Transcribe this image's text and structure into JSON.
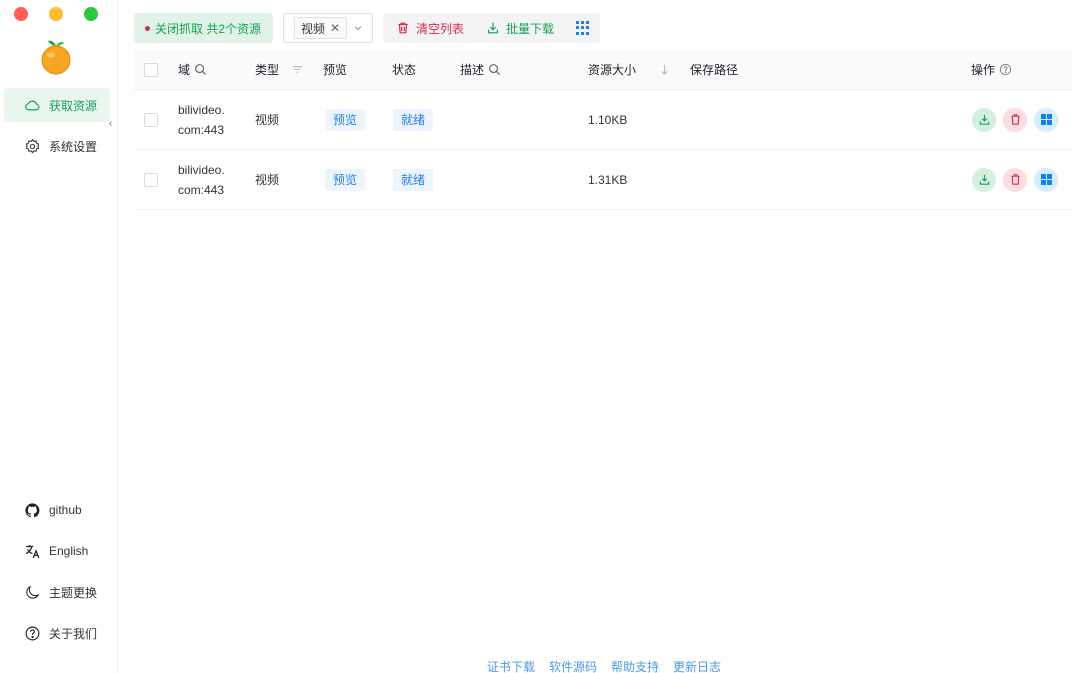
{
  "sidebar": {
    "nav": [
      {
        "label": "获取资源",
        "icon": "cloud-icon",
        "active": true
      },
      {
        "label": "系统设置",
        "icon": "gear-icon",
        "active": false
      }
    ],
    "bottom": [
      {
        "label": "github",
        "icon": "github-icon"
      },
      {
        "label": "English",
        "icon": "translate-icon"
      },
      {
        "label": "主题更换",
        "icon": "moon-icon"
      },
      {
        "label": "关于我们",
        "icon": "help-circle-icon"
      }
    ]
  },
  "toolbar": {
    "capture_label": "关闭抓取 共2个资源",
    "filter_tag": "视频",
    "clear_label": "清空列表",
    "batch_label": "批量下载"
  },
  "table": {
    "headers": {
      "domain": "域",
      "type": "类型",
      "preview": "预览",
      "status": "状态",
      "desc": "描述",
      "size": "资源大小",
      "path": "保存路径",
      "ops": "操作"
    },
    "rows": [
      {
        "domain_line1": "bilivideo.",
        "domain_line2": "com:443",
        "type": "视频",
        "preview": "预览",
        "status": "就绪",
        "desc": "",
        "size": "1.10KB",
        "path": ""
      },
      {
        "domain_line1": "bilivideo.",
        "domain_line2": "com:443",
        "type": "视频",
        "preview": "预览",
        "status": "就绪",
        "desc": "",
        "size": "1.31KB",
        "path": ""
      }
    ]
  },
  "footer": {
    "links": [
      "证书下载",
      "软件源码",
      "帮助支持",
      "更新日志"
    ]
  },
  "colors": {
    "accent_green": "#18a058",
    "danger_red": "#d03050",
    "info_blue": "#2080f0",
    "link_blue": "#4d9be3"
  }
}
